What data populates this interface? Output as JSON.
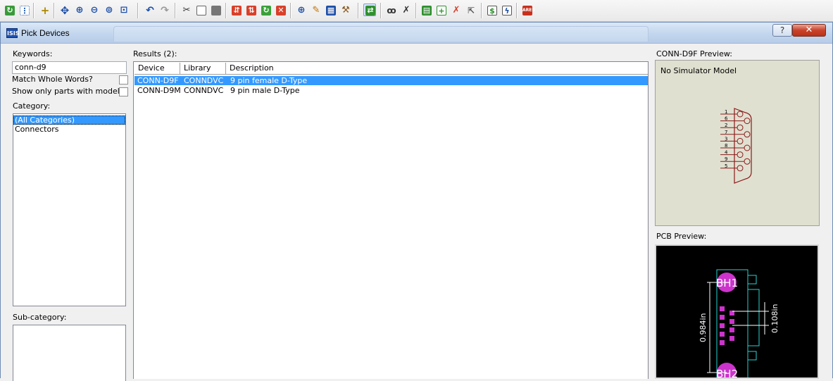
{
  "toolbar": {
    "icons": [
      "refresh-icon",
      "grid-icon",
      "origin-icon",
      "pan-icon",
      "zoom-in-icon",
      "zoom-out-icon",
      "zoom-all-icon",
      "zoom-area-icon",
      "undo-icon",
      "redo-icon",
      "cut-icon",
      "copy-icon",
      "paste-icon",
      "block-copy-icon",
      "block-move-icon",
      "block-rotate-icon",
      "block-delete-icon",
      "pick-device-icon",
      "make-device-icon",
      "package-icon",
      "decompose-icon",
      "wire-autorouter-icon",
      "search-icon",
      "property-tool-icon",
      "netlist-icon",
      "new-sheet-icon",
      "remove-sheet-icon",
      "goto-parent-icon",
      "bill-of-materials-icon",
      "electrical-check-icon",
      "ares-icon"
    ]
  },
  "window": {
    "app_icon": "ISIS",
    "title": "Pick Devices",
    "help_glyph": "?",
    "close_glyph": "✕"
  },
  "search": {
    "keywords_label": "Keywords:",
    "keywords_value": "conn-d9",
    "match_whole_words_label": "Match Whole Words?",
    "show_only_models_label": "Show only parts with models?"
  },
  "category": {
    "label": "Category:",
    "items": [
      "(All Categories)",
      "Connectors"
    ]
  },
  "subcategory": {
    "label": "Sub-category:"
  },
  "results": {
    "label": "Results (2):",
    "columns": [
      "Device",
      "Library",
      "Description"
    ],
    "rows": [
      {
        "device": "CONN-D9F",
        "library": "CONNDVC",
        "description": "9 pin female D-Type"
      },
      {
        "device": "CONN-D9M",
        "library": "CONNDVC",
        "description": "9 pin male D-Type"
      }
    ]
  },
  "schematic_preview": {
    "label": "CONN-D9F Preview:",
    "status": "No Simulator Model",
    "pin_numbers": [
      "1",
      "6",
      "2",
      "7",
      "3",
      "8",
      "4",
      "9",
      "5"
    ]
  },
  "pcb_preview": {
    "label": "PCB Preview:",
    "hole_top": "BH1",
    "hole_bottom": "BH2",
    "dim_height": "0.984in",
    "dim_pitch": "0.108in"
  },
  "colors": {
    "selection": "#3399ff",
    "pcb_pad": "#cc33cc",
    "pcb_outline": "#2ad0d0",
    "schematic_line": "#8b1a1a"
  }
}
